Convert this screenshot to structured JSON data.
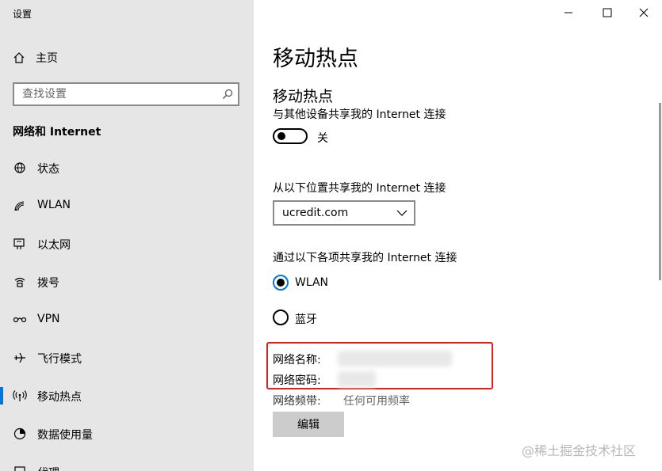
{
  "window": {
    "title": "设置"
  },
  "sidebar": {
    "home_label": "主页",
    "search_placeholder": "查找设置",
    "section": "网络和 Internet",
    "items": [
      {
        "label": "状态",
        "icon": "status-icon"
      },
      {
        "label": "WLAN",
        "icon": "wlan-icon"
      },
      {
        "label": "以太网",
        "icon": "ethernet-icon"
      },
      {
        "label": "拨号",
        "icon": "dialup-icon"
      },
      {
        "label": "VPN",
        "icon": "vpn-icon"
      },
      {
        "label": "飞行模式",
        "icon": "airplane-icon"
      },
      {
        "label": "移动热点",
        "icon": "hotspot-icon",
        "active": true
      },
      {
        "label": "数据使用量",
        "icon": "data-usage-icon"
      },
      {
        "label": "代理",
        "icon": "proxy-icon"
      }
    ]
  },
  "main": {
    "page_title": "移动热点",
    "subtitle": "移动热点",
    "share_desc": "与其他设备共享我的 Internet 连接",
    "toggle_state": "关",
    "share_from_label": "从以下位置共享我的 Internet 连接",
    "share_from_value": "ucredit.com",
    "share_over_label": "通过以下各项共享我的 Internet 连接",
    "radio_options": [
      {
        "label": "WLAN",
        "selected": true
      },
      {
        "label": "蓝牙",
        "selected": false
      }
    ],
    "network_name_label": "网络名称:",
    "network_password_label": "网络密码:",
    "band_label": "网络频带:",
    "band_value": "任何可用频率",
    "edit_button": "编辑"
  },
  "watermark": "@稀土掘金技术社区",
  "colors": {
    "accent": "#0078d7",
    "highlight_border": "#e0201a",
    "sidebar_bg": "#e6e6e6"
  }
}
